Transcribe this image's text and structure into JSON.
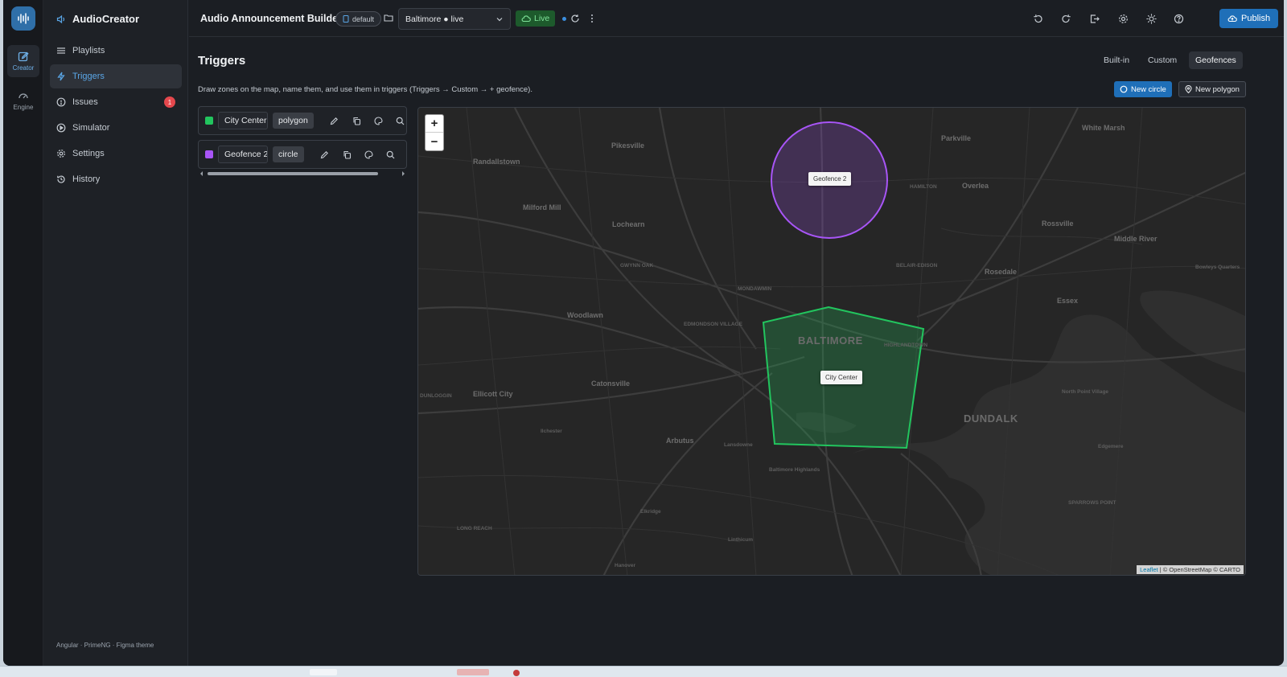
{
  "rail": {
    "items": [
      {
        "label": "Creator"
      },
      {
        "label": "Engine"
      }
    ]
  },
  "brand": {
    "name": "AudioCreator"
  },
  "nav": {
    "items": [
      {
        "label": "Playlists"
      },
      {
        "label": "Triggers"
      },
      {
        "label": "Issues",
        "badge": "1"
      },
      {
        "label": "Simulator"
      },
      {
        "label": "Settings"
      },
      {
        "label": "History"
      }
    ],
    "footer": "Angular · PrimeNG · Figma theme"
  },
  "topbar": {
    "title": "Audio Announcement Builder",
    "profile_pill": "default",
    "environment": "Baltimore ● live",
    "live_label": "Live",
    "publish_label": "Publish"
  },
  "page": {
    "title": "Triggers",
    "tabs": [
      {
        "label": "Built-in",
        "active": false
      },
      {
        "label": "Custom",
        "active": false
      },
      {
        "label": "Geofences",
        "active": true
      }
    ],
    "hint": "Draw zones on the map, name them, and use them in triggers (Triggers → Custom → + geofence).",
    "new_circle_label": "New circle",
    "new_polygon_label": "New polygon"
  },
  "zones": [
    {
      "name": "City Center",
      "type": "polygon",
      "color": "#22c55e"
    },
    {
      "name": "Geofence 2",
      "type": "circle",
      "color": "#a855f7"
    }
  ],
  "map": {
    "zoom_in": "+",
    "zoom_out": "−",
    "labels": {
      "pikesville": "Pikesville",
      "randallstown": "Randallstown",
      "milford_mill": "Milford Mill",
      "lochearn": "Lochearn",
      "woodlawn": "Woodlawn",
      "catonsville": "Catonsville",
      "ellicott_city": "Ellicott City",
      "arbutus": "Arbutus",
      "baltimore": "BALTIMORE",
      "dundalk": "DUNDALK",
      "parkville": "Parkville",
      "overlea": "Overlea",
      "rossville": "Rossville",
      "white_marsh": "White Marsh",
      "middle_river": "Middle River",
      "rosedale": "Rosedale",
      "essex": "Essex",
      "lansdowne": "Lansdowne",
      "linthicum": "Linthicum",
      "hanover": "Hanover",
      "elkridge": "Elkridge",
      "ilchester": "Ilchester",
      "gwynn_oak": "GWYNN OAK",
      "hamilton": "HAMILTON",
      "mondawmin": "MONDAWMIN",
      "edmondson_village": "EDMONDSON VILLAGE",
      "highlandtown": "HIGHLANDTOWN",
      "belair_edison": "BELAIR-EDISON",
      "baltimore_highlands": "Baltimore Highlands",
      "north_point_village": "North Point Village",
      "edgemere": "Edgemere",
      "sparrows_point": "SPARROWS POINT",
      "bowleys_quarters": "Bowleys Quarters",
      "long_reach": "LONG REACH",
      "dunloggin": "DUNLOGGIN"
    },
    "attribution_leaflet": "Leaflet",
    "attribution_rest": "| © OpenStreetMap © CARTO"
  },
  "colors": {
    "accent": "#1f6fb8",
    "live_bg": "#1d5a2c",
    "live_fg": "#7fe39a",
    "polygon_stroke": "#22c55e",
    "circle_stroke": "#a855f7",
    "badge": "#e5484d"
  }
}
